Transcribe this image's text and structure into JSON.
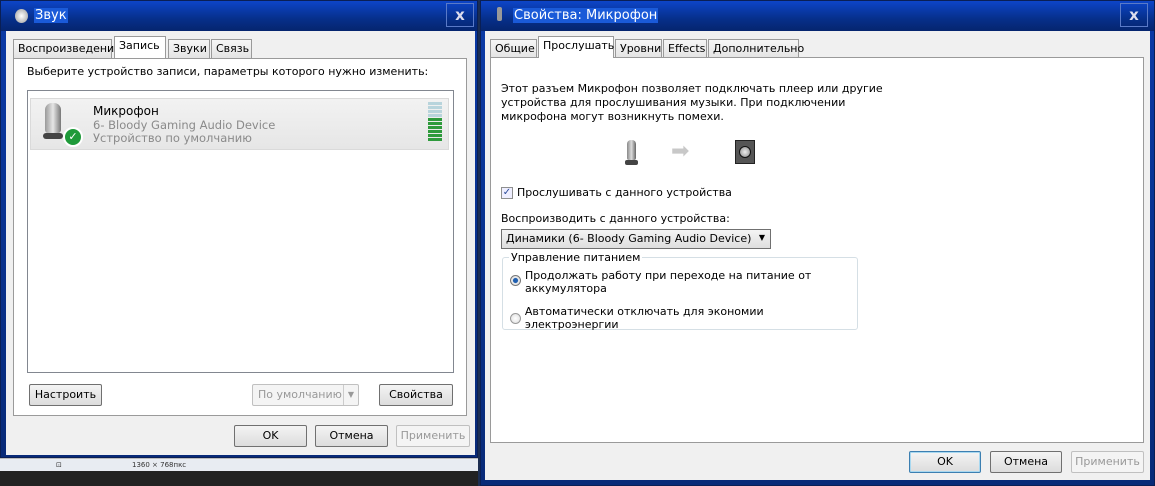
{
  "sound_dialog": {
    "title": "Звук",
    "tabs": [
      "Воспроизведение",
      "Запись",
      "Звуки",
      "Связь"
    ],
    "active_tab": "Запись",
    "instruction": "Выберите устройство записи, параметры которого нужно изменить:",
    "devices": [
      {
        "name": "Микрофон",
        "description": "6- Bloody Gaming Audio Device",
        "status": "Устройство по умолчанию",
        "level_bars_active": 6,
        "level_bars_total": 10
      }
    ],
    "configure_button": "Настроить",
    "default_dropdown": "По умолчанию",
    "properties_button": "Свойства",
    "ok": "OK",
    "cancel": "Отмена",
    "apply": "Применить"
  },
  "statusbar": {
    "resolution": "1360 × 768пкс"
  },
  "mic_properties": {
    "title": "Свойства: Микрофон",
    "tabs": [
      "Общие",
      "Прослушать",
      "Уровни",
      "Effects",
      "Дополнительно"
    ],
    "active_tab": "Прослушать",
    "description_lines": [
      "Этот разъем Микрофон позволяет подключать плеер или другие",
      "устройства для прослушивания музыки. При подключении",
      "микрофона могут возникнуть помехи."
    ],
    "listen_checkbox": {
      "label": "Прослушивать с данного устройства",
      "checked": true
    },
    "playback_label": "Воспроизводить с данного устройства:",
    "playback_device": "Динамики (6- Bloody Gaming Audio Device)",
    "power_group": {
      "title": "Управление питанием",
      "options": [
        {
          "label_lines": [
            "Продолжать работу при переходе на питание от",
            "аккумулятора"
          ],
          "selected": true
        },
        {
          "label_lines": [
            "Автоматически отключать для экономии электроэнергии"
          ],
          "selected": false
        }
      ]
    },
    "ok": "OK",
    "cancel": "Отмена",
    "apply": "Применить"
  }
}
